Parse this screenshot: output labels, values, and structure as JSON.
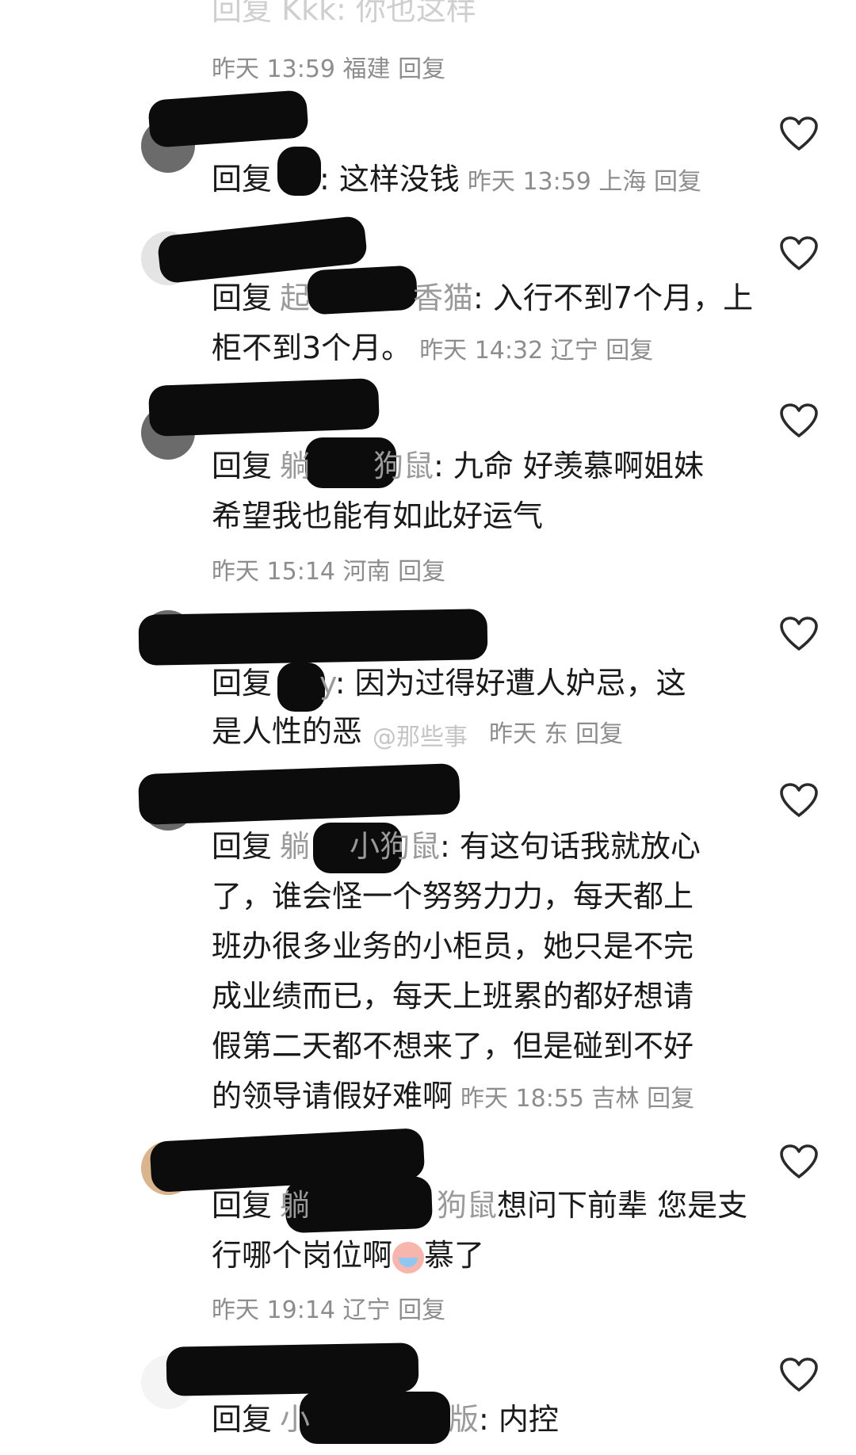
{
  "top_partial": {
    "text": "回复 Kkk: 你也这样",
    "meta": "昨天 13:59 福建 回复"
  },
  "comments": [
    {
      "reply_label": "回复",
      "to": "",
      "colon_text": ": 这样没钱",
      "meta": "昨天 13:59 上海 回复"
    },
    {
      "reply_label": "回复",
      "to": "起",
      "to2": "香猫",
      "line1": ": 入行不到7个月，上",
      "line2": "柜不到3个月。",
      "meta": "昨天 14:32 辽宁 回复"
    },
    {
      "reply_label": "回复",
      "to": "躺",
      "to2": "狗鼠",
      "line1": ": 九命 好羡慕啊姐妹",
      "line2": "希望我也能有如此好运气",
      "meta": "昨天 15:14 河南 回复"
    },
    {
      "reply_label": "回复",
      "to": "y",
      "line1": ": 因为过得好遭人妒忌，这",
      "line2": "是人性的恶",
      "meta": "昨天 东 回复"
    },
    {
      "reply_label": "回复",
      "to": "躺",
      "to2": "小狗鼠",
      "lines": [
        ": 有这句话我就放心",
        "了，谁会怪一个努努力力，每天都上",
        "班办很多业务的小柜员，她只是不完",
        "成业绩而已，每天上班累的都好想请",
        "假第二天都不想来了，但是碰到不好",
        "的领导请假好难啊"
      ],
      "meta": "昨天 18:55 吉林 回复"
    },
    {
      "reply_label": "回复",
      "to": "躺",
      "to2": "狗鼠",
      "line1": "想问下前辈 您是支",
      "line2a": "行哪个岗位啊",
      "line2b": "慕了",
      "meta": "昨天 19:14 辽宁 回复"
    },
    {
      "reply_label": "回复",
      "to": "小",
      "to2": "版",
      "line1": ": 内控"
    }
  ],
  "watermark": "@那些事",
  "icons": {
    "like": "heart-outline-icon",
    "emoji": "crying-face-emoji-icon"
  }
}
